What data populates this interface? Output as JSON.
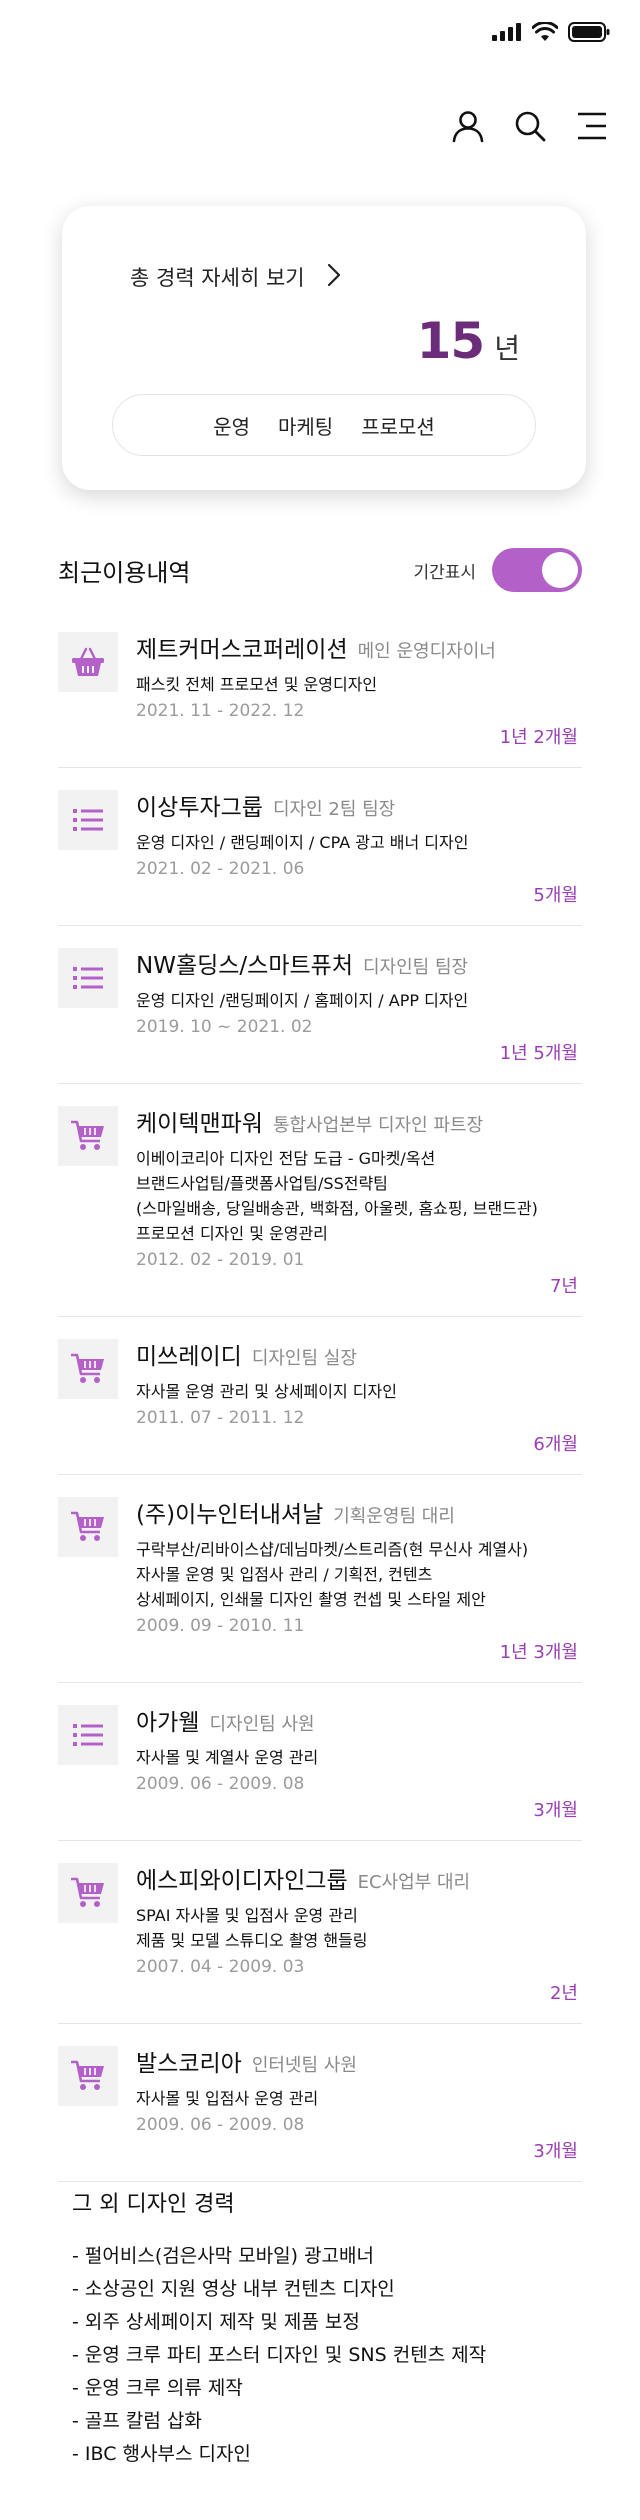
{
  "status_bar": {
    "signal_icon": "signal-icon",
    "wifi_icon": "wifi-icon",
    "battery_icon": "battery-icon"
  },
  "topnav": {
    "icons": [
      "user-icon",
      "search-icon",
      "menu-icon"
    ]
  },
  "career": {
    "link_label": "총 경력 자세히 보기",
    "years": "15",
    "years_unit": "년",
    "tags": [
      "운영",
      "마케팅",
      "프로모션"
    ]
  },
  "history": {
    "title": "최근이용내역",
    "period_label": "기간표시",
    "period_on": true,
    "accent": "#b460c9",
    "entries": [
      {
        "icon": "basket-icon",
        "company": "제트커머스코퍼레이션",
        "role": "메인 운영디자이너",
        "desc": [
          "패스킷 전체 프로모션 및 운영디자인"
        ],
        "dates": "2021. 11 - 2022. 12",
        "duration": "1년 2개월"
      },
      {
        "icon": "list-icon",
        "company": "이상투자그룹",
        "role": "디자인 2팀 팀장",
        "desc": [
          "운영 디자인 / 랜딩페이지 / CPA 광고 배너 디자인"
        ],
        "dates": "2021. 02 - 2021. 06",
        "duration": "5개월"
      },
      {
        "icon": "list-icon",
        "company": "NW홀딩스/스마트퓨처",
        "role": "디자인팀 팀장",
        "desc": [
          "운영 디자인 /랜딩페이지 / 홈페이지 / APP 디자인"
        ],
        "dates": "2019. 10 ~ 2021. 02",
        "duration": "1년 5개월"
      },
      {
        "icon": "cart-icon",
        "company": "케이텍맨파워",
        "role": "통합사업본부 디자인 파트장",
        "desc": [
          "이베이코리아 디자인 전담 도급 - G마켓/옥션",
          "브랜드사업팀/플랫폼사업팀/SS전략팀",
          "(스마일배송, 당일배송관, 백화점, 아울렛, 홈쇼핑, 브랜드관)",
          "프로모션 디자인 및 운영관리"
        ],
        "dates": "2012. 02 - 2019. 01",
        "duration": "7년"
      },
      {
        "icon": "cart-icon",
        "company": "미쓰레이디",
        "role": "디자인팀 실장",
        "desc": [
          "자사몰 운영 관리 및 상세페이지 디자인"
        ],
        "dates": "2011. 07 - 2011. 12",
        "duration": "6개월"
      },
      {
        "icon": "cart-icon",
        "company": "(주)이누인터내셔날",
        "role": "기획운영팀 대리",
        "desc": [
          "구락부산/리바이스샵/데님마켓/스트리즘(현 무신사 계열사)",
          "자사몰 운영 및 입점사 관리 / 기획전, 컨텐츠",
          "상세페이지, 인쇄물 디자인 촬영 컨셉 및 스타일 제안"
        ],
        "dates": "2009. 09 - 2010. 11",
        "duration": "1년 3개월"
      },
      {
        "icon": "list-icon",
        "company": "아가웰",
        "role": "디자인팀 사원",
        "desc": [
          "자사몰 및 계열사 운영 관리"
        ],
        "dates": "2009. 06 - 2009. 08",
        "duration": "3개월"
      },
      {
        "icon": "cart-icon",
        "company": "에스피와이디자인그룹",
        "role": "EC사업부 대리",
        "desc": [
          "SPAI 자사몰 및 입점사 운영 관리",
          "제품 및 모델 스튜디오 촬영 핸들링"
        ],
        "dates": "2007. 04 - 2009. 03",
        "duration": "2년"
      },
      {
        "icon": "cart-icon",
        "company": "발스코리아",
        "role": "인터넷팀 사원",
        "desc": [
          "자사몰 및 입점사 운영 관리"
        ],
        "dates": "2009. 06 - 2009. 08",
        "duration": "3개월"
      }
    ]
  },
  "other": {
    "title": "그 외 디자인 경력",
    "items": [
      "- 펄어비스(검은사막 모바일) 광고배너",
      "- 소상공인 지원 영상 내부 컨텐츠 디자인",
      "- 외주 상세페이지 제작 및 제품 보정",
      "- 운영 크루 파티 포스터 디자인 및 SNS 컨텐츠 제작",
      "- 운영 크루 의류 제작",
      "- 골프 칼럼 삽화",
      "- IBC 행사부스 디자인"
    ]
  }
}
